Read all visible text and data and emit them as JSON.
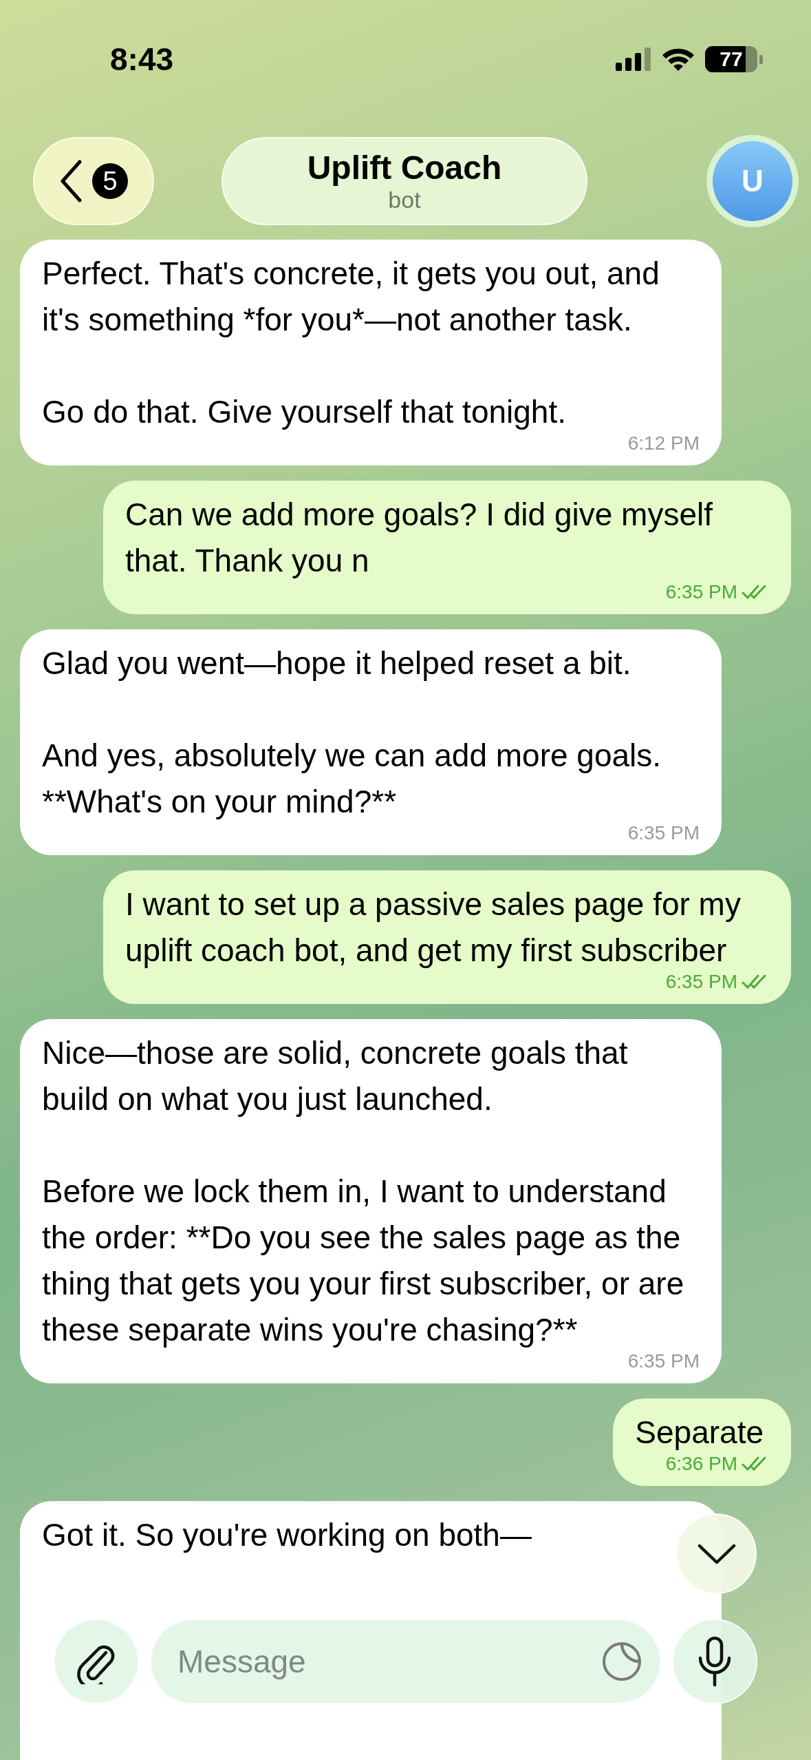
{
  "status_bar": {
    "time": "8:43",
    "battery": "77"
  },
  "header": {
    "back_count": "5",
    "title": "Uplift Coach",
    "subtitle": "bot",
    "avatar": "U"
  },
  "messages": [
    {
      "kind": "incoming",
      "text": "Perfect. That's concrete, it gets you out, and it's something *for you*—not another task.\n\nGo do that. Give yourself that tonight.",
      "time": "6:12 PM"
    },
    {
      "kind": "outgoing",
      "text": "Can we add more goals? I did give myself that. Thank you n",
      "time": "6:35 PM",
      "read": true
    },
    {
      "kind": "incoming",
      "text": "Glad you went—hope it helped reset a bit.\n\nAnd yes, absolutely we can add more goals. **What's on your mind?**",
      "time": "6:35 PM"
    },
    {
      "kind": "outgoing",
      "text": "I want to set up a passive sales page for my uplift coach bot, and get my first subscriber",
      "time": "6:35 PM",
      "read": true
    },
    {
      "kind": "incoming",
      "text": "Nice—those are solid, concrete goals that build on what you just launched.\n\nBefore we lock them in, I want to understand the order: **Do you see the sales page as the thing that gets you your first subscriber, or are these separate wins you're chasing?**",
      "time": "6:35 PM"
    },
    {
      "kind": "outgoing",
      "text": "Separate",
      "time": "6:36 PM",
      "read": true
    },
    {
      "kind": "incoming",
      "text": "Got it. So you're working on both—"
    }
  ],
  "composer": {
    "placeholder": "Message"
  }
}
